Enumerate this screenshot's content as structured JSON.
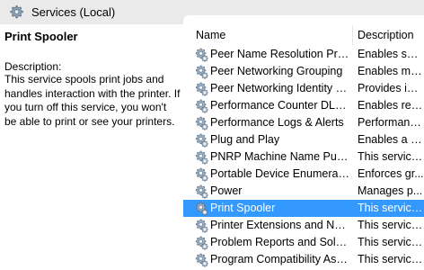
{
  "header": {
    "title": "Services (Local)",
    "icon": "services-gear-icon"
  },
  "details": {
    "service_name": "Print Spooler",
    "description_label": "Description:",
    "description_text": "This service spools print jobs and handles interaction with the printer. If you turn off this service, you won't be able to print or see your printers."
  },
  "list": {
    "columns": {
      "name": "Name",
      "description": "Description"
    },
    "selected_color": "#3399ff",
    "rows": [
      {
        "name": "Peer Name Resolution Prot...",
        "description": "Enables serv...",
        "selected": false
      },
      {
        "name": "Peer Networking Grouping",
        "description": "Enables mul...",
        "selected": false
      },
      {
        "name": "Peer Networking Identity M...",
        "description": "Provides ide...",
        "selected": false
      },
      {
        "name": "Performance Counter DLL ...",
        "description": "Enables rem...",
        "selected": false
      },
      {
        "name": "Performance Logs & Alerts",
        "description": "Performanc...",
        "selected": false
      },
      {
        "name": "Plug and Play",
        "description": "Enables a c...",
        "selected": false
      },
      {
        "name": "PNRP Machine Name Publi...",
        "description": "This service ...",
        "selected": false
      },
      {
        "name": "Portable Device Enumerator...",
        "description": "Enforces gr...",
        "selected": false
      },
      {
        "name": "Power",
        "description": "Manages p...",
        "selected": false
      },
      {
        "name": "Print Spooler",
        "description": "This service ...",
        "selected": true
      },
      {
        "name": "Printer Extensions and Notif...",
        "description": "This service ...",
        "selected": false
      },
      {
        "name": "Problem Reports and Soluti...",
        "description": "This service ...",
        "selected": false
      },
      {
        "name": "Program Compatibility Assi...",
        "description": "This service ...",
        "selected": false
      }
    ]
  }
}
